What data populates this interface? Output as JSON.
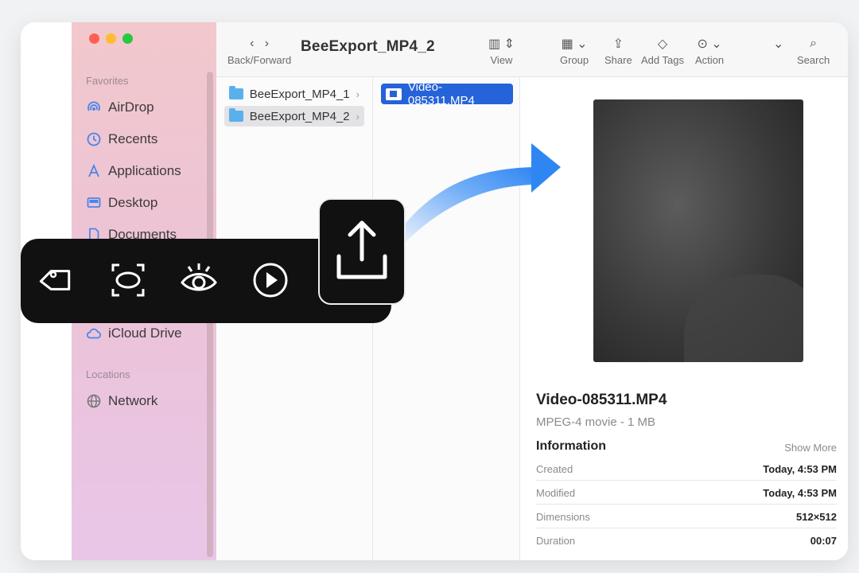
{
  "window": {
    "title": "BeeExport_MP4_2"
  },
  "sidebar": {
    "favorites_header": "Favorites",
    "locations_header": "Locations",
    "items": [
      {
        "label": "AirDrop",
        "icon": "airdrop-icon"
      },
      {
        "label": "Recents",
        "icon": "clock-icon"
      },
      {
        "label": "Applications",
        "icon": "applications-icon"
      },
      {
        "label": "Desktop",
        "icon": "desktop-icon"
      },
      {
        "label": "Documents",
        "icon": "document-icon"
      },
      {
        "label": "iCloud Drive",
        "icon": "cloud-icon"
      },
      {
        "label": "Network",
        "icon": "globe-icon"
      }
    ]
  },
  "toolbar": {
    "back_forward_label": "Back/Forward",
    "view_label": "View",
    "group_label": "Group",
    "share_label": "Share",
    "add_tags_label": "Add Tags",
    "action_label": "Action",
    "search_label": "Search"
  },
  "columns": {
    "folders": [
      {
        "name": "BeeExport_MP4_1"
      },
      {
        "name": "BeeExport_MP4_2"
      }
    ],
    "files": [
      {
        "name": "Video-085311.MP4"
      }
    ]
  },
  "preview": {
    "file_name": "Video-085311.MP4",
    "file_kind": "MPEG-4 movie - 1 MB",
    "information_label": "Information",
    "show_more": "Show More",
    "info": [
      {
        "key": "Created",
        "value": "Today, 4:53 PM"
      },
      {
        "key": "Modified",
        "value": "Today, 4:53 PM"
      },
      {
        "key": "Dimensions",
        "value": "512×512"
      },
      {
        "key": "Duration",
        "value": "00:07"
      }
    ]
  },
  "quick_actions": {
    "icons": [
      "tag-icon",
      "crop-icon",
      "eye-icon",
      "play-icon"
    ],
    "highlight": "share-icon"
  },
  "colors": {
    "selection_blue": "#2563d8",
    "sidebar_pink": "#f2c8cc",
    "arrow_blue": "#3b8ff5"
  }
}
